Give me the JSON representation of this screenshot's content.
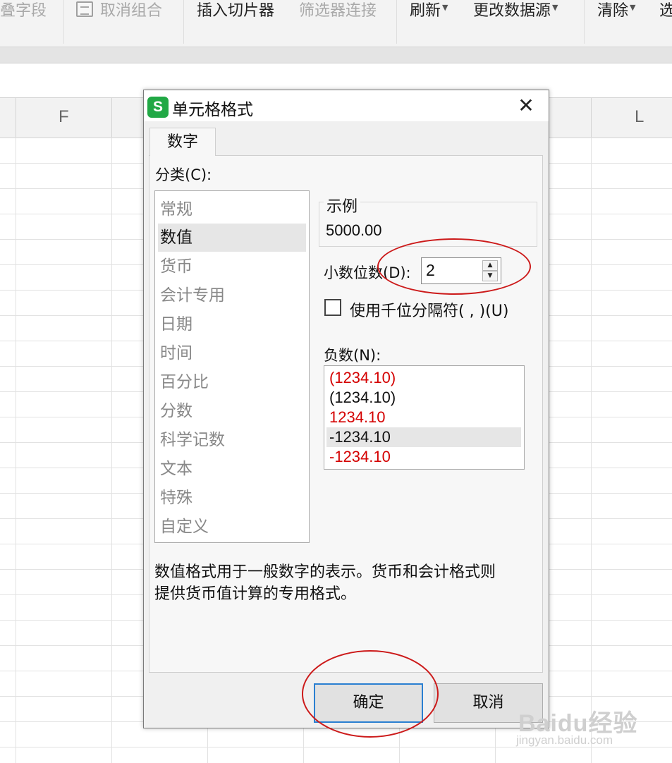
{
  "toolbar": {
    "items": [
      {
        "label": "叠字段",
        "disabled": true
      },
      {
        "label": "取消组合",
        "disabled": true,
        "icon": "group-icon"
      },
      {
        "label": "插入切片器",
        "disabled": false
      },
      {
        "label": "筛选器连接",
        "disabled": true
      },
      {
        "label": "刷新",
        "disabled": false,
        "dropdown": true
      },
      {
        "label": "更改数据源",
        "disabled": false,
        "dropdown": true
      },
      {
        "label": "清除",
        "disabled": false,
        "dropdown": true
      },
      {
        "label": "选",
        "disabled": false
      }
    ]
  },
  "sheet": {
    "columns": [
      "F",
      "L"
    ]
  },
  "dialog": {
    "title": "单元格格式",
    "app_icon_text": "S",
    "close_glyph": "✕",
    "tab": "数字",
    "category_label": "分类(C):",
    "categories": [
      "常规",
      "数值",
      "货币",
      "会计专用",
      "日期",
      "时间",
      "百分比",
      "分数",
      "科学记数",
      "文本",
      "特殊",
      "自定义"
    ],
    "selected_category": "数值",
    "sample_label": "示例",
    "sample_value": "5000.00",
    "decimal_label": "小数位数(D):",
    "decimal_value": "2",
    "thousands_label": "使用千位分隔符( , )(U)",
    "thousands_checked": false,
    "negative_label": "负数(N):",
    "negative_options": [
      {
        "text": "(1234.10)",
        "color": "red"
      },
      {
        "text": "(1234.10)",
        "color": "black"
      },
      {
        "text": "1234.10",
        "color": "red"
      },
      {
        "text": "-1234.10",
        "color": "black",
        "selected": true
      },
      {
        "text": "-1234.10",
        "color": "red"
      }
    ],
    "description_line1": "数值格式用于一般数字的表示。货币和会计格式则",
    "description_line2": "提供货币值计算的专用格式。",
    "ok_label": "确定",
    "cancel_label": "取消"
  },
  "watermark": {
    "logo": "Baidu经验",
    "url": "jingyan.baidu.com"
  },
  "colors": {
    "accent": "#2a7fd1",
    "app_icon": "#21a845",
    "negative_red": "#d40000",
    "annotation_red": "#cc1a1a"
  }
}
